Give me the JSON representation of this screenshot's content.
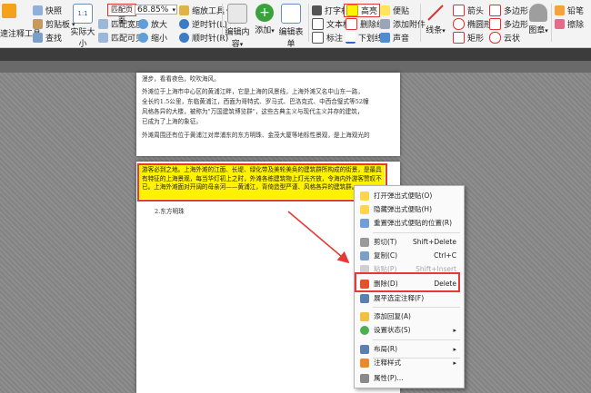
{
  "ribbon": {
    "annotation_tool": "速注释工具",
    "snapshot": "快照",
    "clipboard": "剪贴板",
    "find": "查找",
    "actual_size": "实际大小",
    "fit_page": "匹配页面",
    "fit_width": "匹配宽度",
    "fit_visible": "匹配可见",
    "zoom_value": "68.85%",
    "zoom_tool": "缩放工具",
    "zoom_in": "放大",
    "zoom_out": "缩小",
    "rotate_cw": "逆时针(L)",
    "rotate_ccw": "顺时针(R)",
    "edit_content": "编辑内容",
    "add": "添加",
    "edit_form": "编辑表单",
    "typewriter": "打字机",
    "textbox": "文本框",
    "callout": "标注",
    "highlight": "高亮",
    "strikeout": "删除线",
    "underline": "下划线",
    "note": "便贴",
    "attach_file": "添加附件",
    "sound": "声音",
    "line": "线条",
    "arrow": "箭头",
    "ellipse": "椭圆形",
    "rectangle": "矩形",
    "polygon": "多边形",
    "polyline": "多边形",
    "cloud": "云状",
    "stamp": "图章",
    "pencil": "铅笔",
    "eraser": "擦除"
  },
  "doc": {
    "p1_line0": "漫步，看看夜色，吹吹海风。",
    "p1_line1": "外滩位于上海市中心区的黄浦江畔，它是上海的风景线，上海外滩又名中山东一路，",
    "p1_line2": "全长约1.5公里，东临黄浦江，西面为哥特式、罗马式、巴洛克式、中西合璧式等52幢",
    "p1_line3": "风格各异的大楼，被称为\"万国建筑博览群\"，这些古典主义与现代主义并存的建筑，",
    "p1_line4": "已成为了上海的象征。",
    "p1_line5": "外滩周围还有位于黄浦江对岸浦东的东方明珠、金茂大厦等地标性景观，是上海观光的",
    "hl_text": "游客必到之地。上海外滩的江面、长堤、绿化带及美轮美奂的建筑群所构成的街景，是最具有特征的上海景观，每当华灯初上之时，外滩各栋建筑物上灯光齐放，令海内外游客赞叹不已。上海外滩面对开阔的母亲河——黄浦江，背倚造型严谨、风格各异的建筑群。",
    "p2_heading": "2.东方明珠"
  },
  "context_menu": {
    "items": [
      {
        "label": "打开弹出式便贴(O)",
        "shortcut": ""
      },
      {
        "label": "隐藏弹出式便贴(H)",
        "shortcut": ""
      },
      {
        "label": "重置弹出式便贴的位置(R)",
        "shortcut": ""
      },
      {
        "label": "剪切(T)",
        "shortcut": "Shift+Delete"
      },
      {
        "label": "复制(C)",
        "shortcut": "Ctrl+C"
      },
      {
        "label": "粘贴(P)",
        "shortcut": "Shift+Insert"
      },
      {
        "label": "删除(D)",
        "shortcut": "Delete"
      },
      {
        "label": "展平选定注释(F)",
        "shortcut": ""
      },
      {
        "label": "添加回复(A)",
        "shortcut": ""
      },
      {
        "label": "设置状态(S)",
        "shortcut": ""
      },
      {
        "label": "布局(R)",
        "shortcut": ""
      },
      {
        "label": "注释样式",
        "shortcut": ""
      },
      {
        "label": "属性(P)...",
        "shortcut": ""
      }
    ]
  },
  "colors": {
    "highlight": "#fff200",
    "annotation_red": "#e53935"
  }
}
